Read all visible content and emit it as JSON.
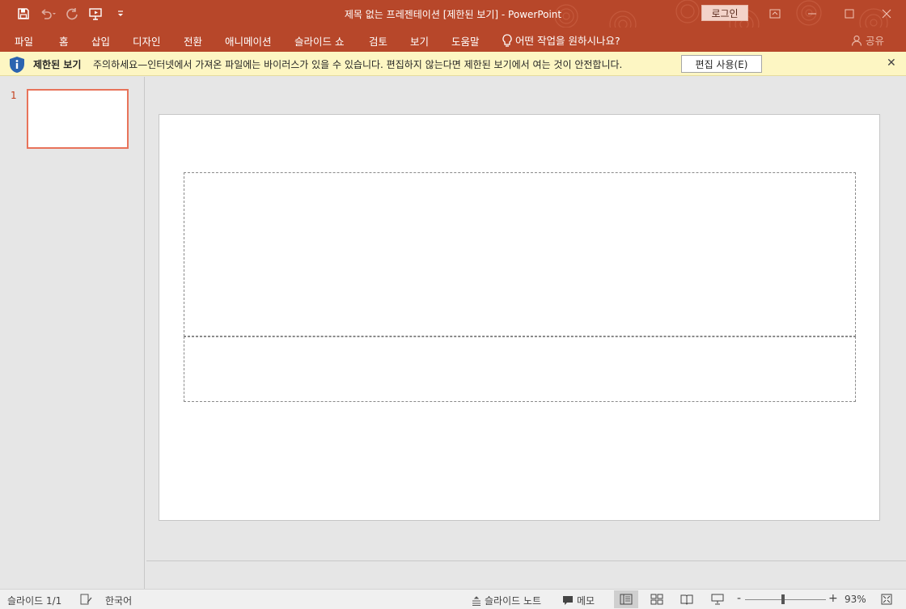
{
  "window": {
    "title": "제목 없는 프레젠테이션 [제한된 보기]  -  PowerPoint",
    "login_label": "로그인"
  },
  "quick_access": {
    "icons": [
      "save-icon",
      "undo-icon",
      "redo-icon",
      "present-icon",
      "customize-icon"
    ]
  },
  "ribbon": {
    "tabs": [
      "파일",
      "홈",
      "삽입",
      "디자인",
      "전환",
      "애니메이션",
      "슬라이드 쇼",
      "검토",
      "보기",
      "도움말"
    ],
    "tell_me": "어떤 작업을 원하시나요?",
    "share": "공유"
  },
  "protected_view": {
    "title": "제한된 보기",
    "message": "주의하세요—인터넷에서 가져온 파일에는 바이러스가 있을 수 있습니다. 편집하지 않는다면 제한된 보기에서 여는 것이 안전합니다.",
    "enable_label": "편집 사용(E)",
    "close_glyph": "✕"
  },
  "thumbnails": {
    "items": [
      {
        "number": "1"
      }
    ]
  },
  "status": {
    "slide_count": "슬라이드 1/1",
    "language": "한국어",
    "notes_label": "슬라이드 노트",
    "comments_label": "메모",
    "zoom_minus": "-",
    "zoom_plus": "+",
    "zoom_level": "93%",
    "zoom_fraction": 0.47
  },
  "colors": {
    "accent": "#b7472a",
    "message_bar": "#fdf6c3",
    "thumb_border": "#e8735a"
  }
}
